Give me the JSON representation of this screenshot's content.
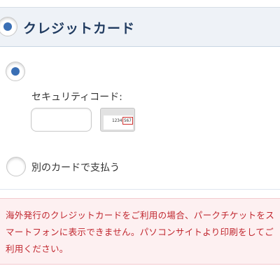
{
  "payment": {
    "title": "クレジットカード",
    "saved_card": {
      "security_code_label": "セキュリティコード:",
      "security_code_value": "",
      "card_image": {
        "number_sample": "1234",
        "cvv_sample": "567"
      }
    },
    "alternative": {
      "label": "別のカードで支払う"
    }
  },
  "warning": {
    "text": "海外発行のクレジットカードをご利用の場合、パークチケットをスマートフォンに表示できません。パソコンサイトより印刷をしてご利用ください。"
  },
  "colors": {
    "accent": "#3a6fb5",
    "title": "#1f3a5f",
    "warning_text": "#c0262e",
    "warning_bg": "#fdf0f1"
  }
}
